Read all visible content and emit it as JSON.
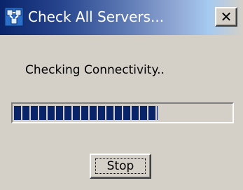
{
  "window": {
    "title": "Check All Servers...",
    "close_label": "✕"
  },
  "icons": {
    "app": "server-network-icon",
    "close": "close-icon"
  },
  "message": "Checking Connectivity..",
  "progress": {
    "fraction": 0.66
  },
  "buttons": {
    "stop_label": "Stop"
  },
  "colors": {
    "title_bar_start": "#0a246a",
    "title_bar_end": "#a6caf0",
    "dialog_face": "#d4d0c8",
    "progress_fill": "#0a246a"
  }
}
